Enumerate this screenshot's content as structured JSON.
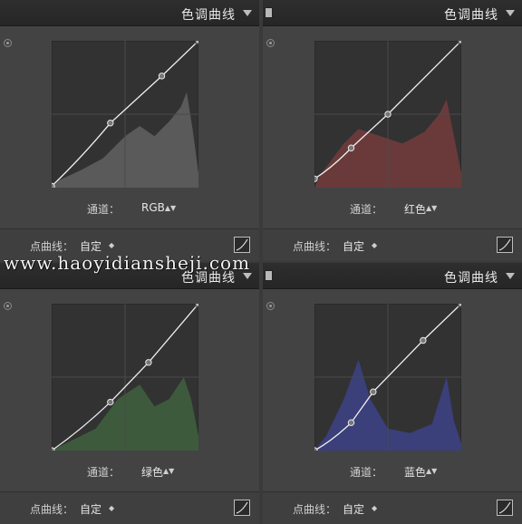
{
  "panels": [
    {
      "title": "色调曲线",
      "channel_label": "通道：",
      "channel_value": "RGB",
      "point_curve_label": "点曲线：",
      "point_curve_value": "自定",
      "histogram_color": "#5a5a5a",
      "curve_points": [
        [
          0,
          0.01
        ],
        [
          0.4,
          0.44
        ],
        [
          0.75,
          0.76
        ],
        [
          1,
          1
        ]
      ]
    },
    {
      "title": "色调曲线",
      "channel_label": "通道：",
      "channel_value": "红色",
      "point_curve_label": "点曲线：",
      "point_curve_value": "自定",
      "histogram_color": "#6a3a3a",
      "curve_points": [
        [
          0,
          0.06
        ],
        [
          0.25,
          0.27
        ],
        [
          0.5,
          0.5
        ],
        [
          1,
          1
        ]
      ]
    },
    {
      "title": "色调曲线",
      "channel_label": "通道：",
      "channel_value": "绿色",
      "point_curve_label": "点曲线：",
      "point_curve_value": "自定",
      "histogram_color": "#3d5a3d",
      "curve_points": [
        [
          0,
          0.0
        ],
        [
          0.4,
          0.33
        ],
        [
          0.66,
          0.6
        ],
        [
          1,
          1
        ]
      ]
    },
    {
      "title": "色调曲线",
      "channel_label": "通道：",
      "channel_value": "蓝色",
      "point_curve_label": "点曲线：",
      "point_curve_value": "自定",
      "histogram_color": "#3b3f7a",
      "curve_points": [
        [
          0,
          0.0
        ],
        [
          0.25,
          0.19
        ],
        [
          0.4,
          0.4
        ],
        [
          0.74,
          0.75
        ],
        [
          1,
          1
        ]
      ]
    }
  ],
  "watermark": "www.haoyidiansheji.com"
}
